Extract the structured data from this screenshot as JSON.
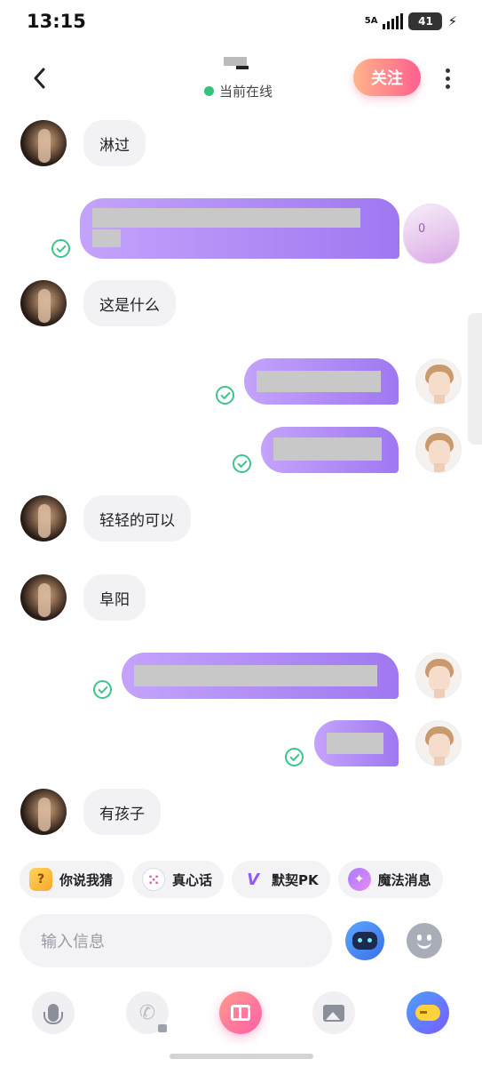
{
  "status_bar": {
    "time": "13:15",
    "network": "5A",
    "battery": "41"
  },
  "header": {
    "name_masked": "",
    "status": "当前在线",
    "follow_label": "关注"
  },
  "messages": [
    {
      "side": "left",
      "text": "淋过"
    },
    {
      "side": "right",
      "redacted": true,
      "avatar_badge": "0"
    },
    {
      "side": "left",
      "text": "这是什么"
    },
    {
      "side": "right",
      "redacted": true
    },
    {
      "side": "right",
      "redacted": true
    },
    {
      "side": "left",
      "text": "轻轻的可以"
    },
    {
      "side": "left",
      "text": "阜阳"
    },
    {
      "side": "right",
      "redacted": true
    },
    {
      "side": "right",
      "redacted": true
    },
    {
      "side": "left",
      "text": "有孩子"
    }
  ],
  "quick_actions": [
    {
      "label": "你说我猜",
      "icon": "question-icon"
    },
    {
      "label": "真心话",
      "icon": "dice-icon"
    },
    {
      "label": "默契PK",
      "icon": "vs-icon"
    },
    {
      "label": "魔法消息",
      "icon": "magic-icon"
    }
  ],
  "input": {
    "placeholder": "输入信息"
  },
  "toolbar": [
    "mic-icon",
    "phone-icon",
    "gift-icon",
    "image-icon",
    "gamepad-icon"
  ],
  "colors": {
    "accent_purple": "#9f78f1",
    "follow_pink": "#ff5f8f",
    "online_green": "#35c27a"
  }
}
